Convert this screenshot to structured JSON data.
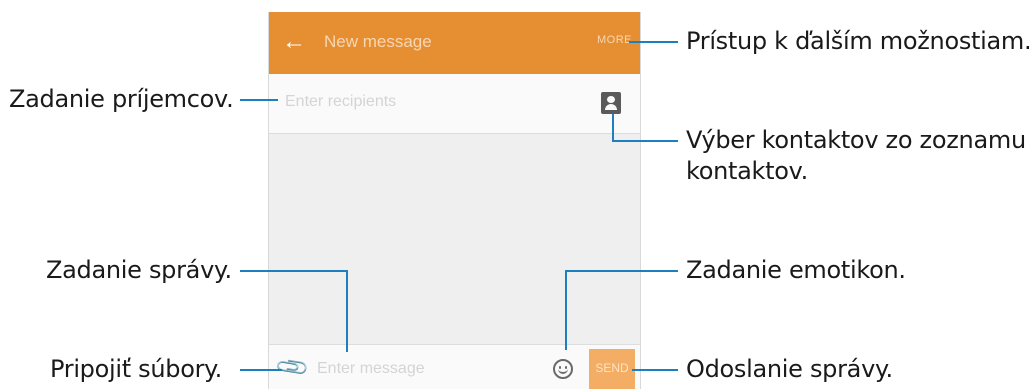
{
  "screen": {
    "title": "New message",
    "more_label": "MORE",
    "recipients_placeholder": "Enter recipients",
    "message_placeholder": "Enter message",
    "send_label": "SEND",
    "accent_color": "#e68e32",
    "icons": {
      "back": "back-arrow-icon",
      "contacts": "contacts-icon",
      "attach": "paperclip-icon",
      "emoticon": "smiley-icon"
    }
  },
  "callouts": {
    "more_options": "Prístup k ďalším možnostiam.",
    "recipients": "Zadanie príjemcov.",
    "contacts_line1": "Výber kontaktov zo zoznamu",
    "contacts_line2": "kontaktov.",
    "message": "Zadanie správy.",
    "emoticon": "Zadanie emotikon.",
    "attach": "Pripojiť súbory.",
    "send": "Odoslanie správy."
  }
}
